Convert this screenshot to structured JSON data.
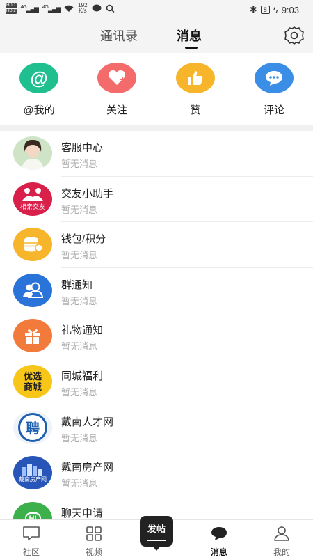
{
  "status_bar": {
    "sim1": "HD 1",
    "sim2": "HD 2",
    "signal1": "4G",
    "signal2": "4G",
    "speed_value": "192",
    "speed_unit": "K/s",
    "battery": "8",
    "time": "9:03"
  },
  "header": {
    "tabs": [
      {
        "label": "通讯录"
      },
      {
        "label": "消息"
      }
    ]
  },
  "quick_actions": [
    {
      "label": "@我的",
      "icon": "at-icon",
      "color": "#1fbf8f"
    },
    {
      "label": "关注",
      "icon": "heart-plus-icon",
      "color": "#f36b6b"
    },
    {
      "label": "赞",
      "icon": "thumbs-up-icon",
      "color": "#f7b52c"
    },
    {
      "label": "评论",
      "icon": "comment-icon",
      "color": "#3a8ee6"
    }
  ],
  "messages": [
    {
      "title": "客服中心",
      "subtitle": "暂无消息",
      "avatar": "customer-service-avatar"
    },
    {
      "title": "交友小助手",
      "subtitle": "暂无消息",
      "avatar": "dating-helper-avatar",
      "avatar_text": "相亲交友",
      "color": "#d8204a"
    },
    {
      "title": "钱包/积分",
      "subtitle": "暂无消息",
      "avatar": "wallet-icon",
      "color": "#f7b52c"
    },
    {
      "title": "群通知",
      "subtitle": "暂无消息",
      "avatar": "group-icon",
      "color": "#2a73d9"
    },
    {
      "title": "礼物通知",
      "subtitle": "暂无消息",
      "avatar": "gift-icon",
      "color": "#f27a3a"
    },
    {
      "title": "同城福利",
      "subtitle": "暂无消息",
      "avatar": "local-benefits-avatar",
      "avatar_text_1": "优选",
      "avatar_text_2": "商城",
      "color": "#f7c619"
    },
    {
      "title": "戴南人才网",
      "subtitle": "暂无消息",
      "avatar": "talent-network-avatar",
      "avatar_text": "聘",
      "color": "#1f5fb0"
    },
    {
      "title": "戴南房产网",
      "subtitle": "暂无消息",
      "avatar": "real-estate-avatar",
      "avatar_text": "戴南房产网",
      "color": "#2756b8"
    },
    {
      "title": "聊天申请",
      "subtitle": "",
      "avatar": "chat-request-avatar",
      "avatar_text": "HI",
      "color": "#3cb04a"
    }
  ],
  "bottom_nav": [
    {
      "label": "社区",
      "icon": "community-icon"
    },
    {
      "label": "视频",
      "icon": "video-grid-icon"
    },
    {
      "label": "发帖",
      "icon": "post-button"
    },
    {
      "label": "消息",
      "icon": "message-icon",
      "active": true
    },
    {
      "label": "我的",
      "icon": "profile-icon"
    }
  ]
}
